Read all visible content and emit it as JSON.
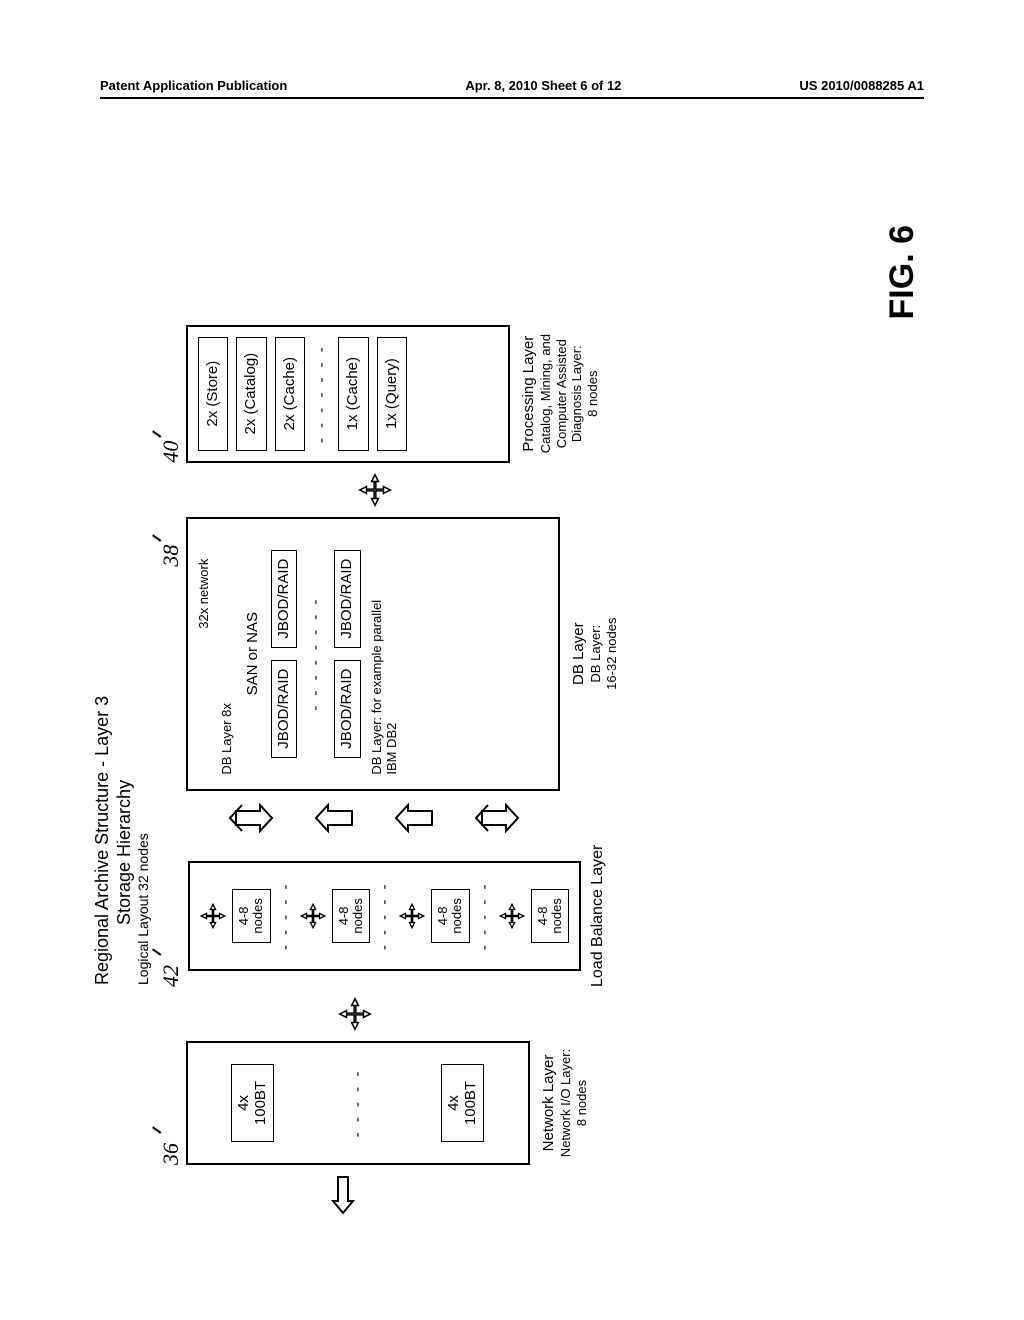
{
  "header": {
    "left": "Patent Application Publication",
    "mid": "Apr. 8, 2010   Sheet 6 of 12",
    "right": "US 2010/0088285 A1"
  },
  "title": {
    "line1": "Regional Archive Structure - Layer 3",
    "line2": "Storage Hierarchy",
    "logical": "Logical Layout 32 nodes"
  },
  "refs": {
    "network": "36",
    "loadbal": "42",
    "db": "38",
    "proc": "40"
  },
  "network": {
    "cell1_a": "4x",
    "cell1_b": "100BT",
    "dashes": "- - - - -",
    "cell2_a": "4x",
    "cell2_b": "100BT",
    "label": "Network Layer",
    "sub": "Network I/O Layer:\n8 nodes"
  },
  "loadbal": {
    "item_a": "4-8",
    "item_b": "nodes",
    "dashes": "- - - - -",
    "label": "Load Balance Layer"
  },
  "db": {
    "top_net": "32x network",
    "sublabel": "DB Layer 8x",
    "sanNas": "SAN or NAS",
    "jbod": "JBOD/RAID",
    "dashes": "- - - - - - - -",
    "annot": "DB Layer: for example parallel\nIBM DB2",
    "label": "DB Layer",
    "sub": "DB Layer:\n16-32 nodes"
  },
  "proc": {
    "items": [
      "2x (Store)",
      "2x (Catalog)",
      "2x (Cache)",
      "1x (Cache)",
      "1x (Query)"
    ],
    "dashes": "- - - - - - -",
    "label": "Processing Layer",
    "sub": "Catalog, Mining, and\nComputer Assisted\nDiagnosis Layer:\n8 nodes"
  },
  "figure": "FIG. 6"
}
